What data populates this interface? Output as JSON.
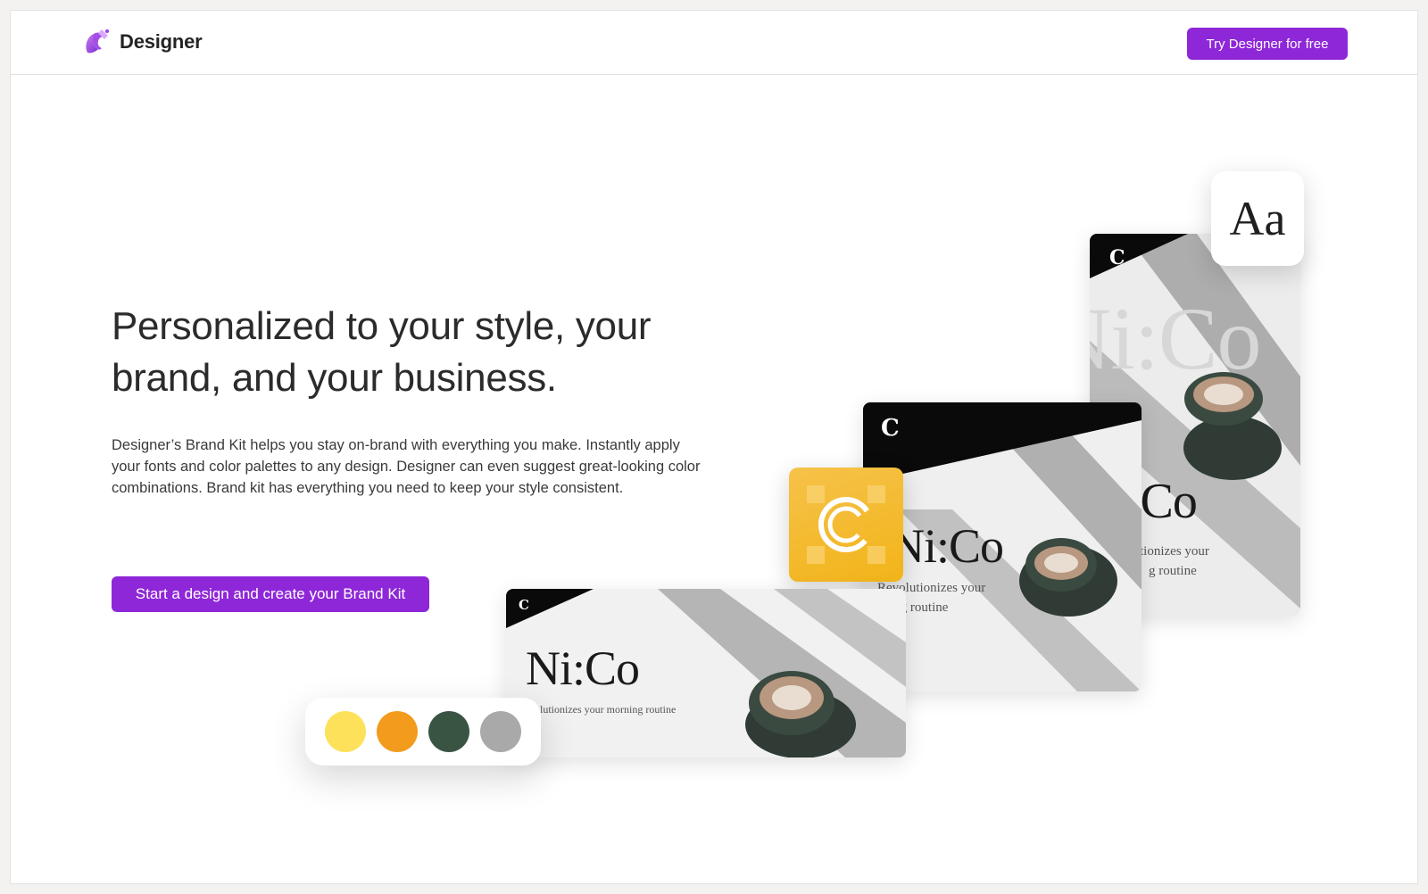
{
  "app": {
    "name": "Designer"
  },
  "header": {
    "cta_label": "Try Designer for free"
  },
  "hero": {
    "headline": "Personalized to your style, your brand, and your business.",
    "description": "Designer’s Brand Kit helps you stay on-brand with everything you make. Instantly apply your fonts and color palettes to any design. Designer can even suggest great-looking color combinations. Brand kit has everything you need to keep your style consistent.",
    "cta_label": "Start a design and create your Brand Kit"
  },
  "showcase": {
    "typeface_sample": "Aa",
    "logo_glyph": "C",
    "cards": [
      {
        "brand": "Ni:Co",
        "tagline": "tionizes your",
        "tagline2": "g routine"
      },
      {
        "brand": "Ni:Co",
        "tagline": "Revolutionizes your",
        "tagline2": "ing routine"
      },
      {
        "brand": "Ni:Co",
        "tagline": "olutionizes your morning routine"
      }
    ],
    "palette": [
      {
        "name": "yellow",
        "color": "#fde15a"
      },
      {
        "name": "orange",
        "color": "#f29b1c"
      },
      {
        "name": "dark-green",
        "color": "#3a5443"
      },
      {
        "name": "gray",
        "color": "#a9a9a9"
      }
    ]
  },
  "colors": {
    "accent": "#8e27d8"
  }
}
